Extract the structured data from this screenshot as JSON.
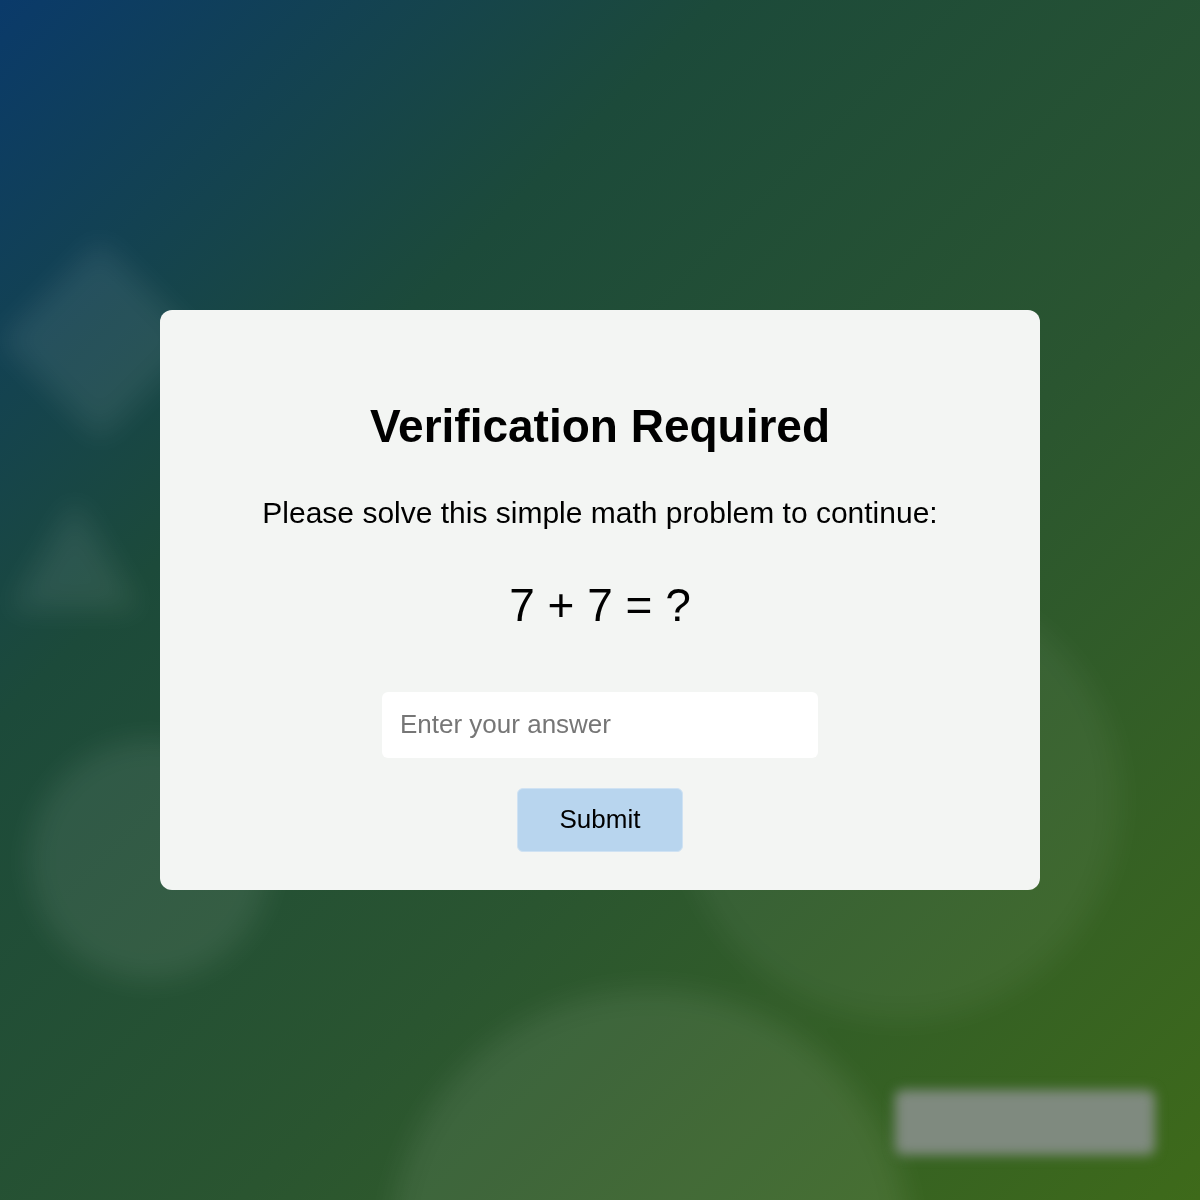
{
  "dialog": {
    "title": "Verification Required",
    "instruction": "Please solve this simple math problem to continue:",
    "problem": "7 + 7 = ?"
  },
  "answer": {
    "placeholder": "Enter your answer"
  },
  "submit": {
    "label": "Submit"
  }
}
